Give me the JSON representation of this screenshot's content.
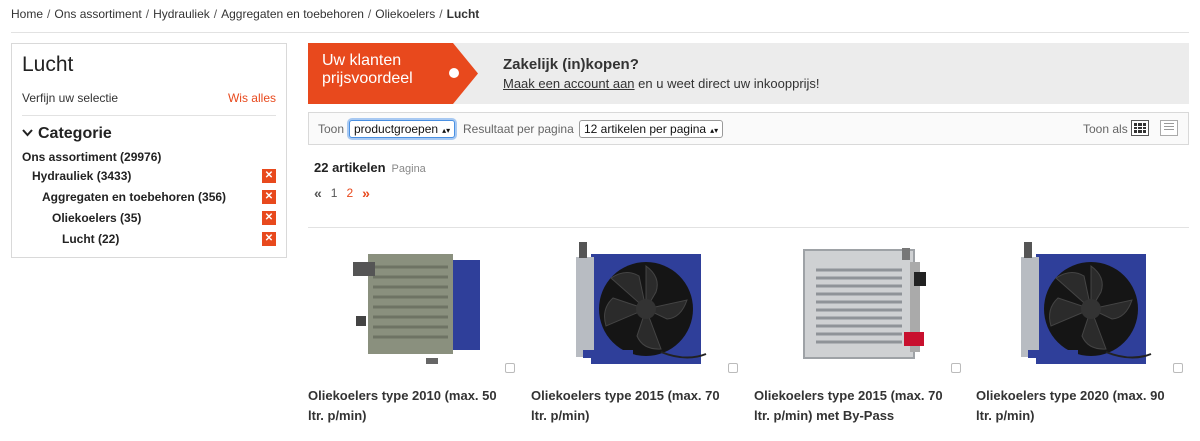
{
  "breadcrumb": {
    "items": [
      "Home",
      "Ons assortiment",
      "Hydrauliek",
      "Aggregaten en toebehoren",
      "Oliekoelers"
    ],
    "current": "Lucht",
    "separator": "/"
  },
  "sidebar": {
    "title": "Lucht",
    "refine_label": "Verfijn uw selectie",
    "clear_all": "Wis alles",
    "category_heading": "Categorie",
    "categories": [
      {
        "label": "Ons assortiment (29976)",
        "removable": false
      },
      {
        "label": "Hydrauliek (3433)",
        "removable": true
      },
      {
        "label": "Aggregaten en toebehoren (356)",
        "removable": true
      },
      {
        "label": "Oliekoelers (35)",
        "removable": true
      },
      {
        "label": "Lucht (22)",
        "removable": true
      }
    ],
    "remove_glyph": "✕"
  },
  "banner": {
    "badge_line1": "Uw klanten",
    "badge_line2": "prijsvoordeel",
    "heading": "Zakelijk (in)kopen?",
    "link_text": "Maak een account aan",
    "rest_text": " en u weet direct uw inkoopprijs!"
  },
  "toolbar": {
    "show_label": "Toon",
    "show_value": "productgroepen",
    "per_page_label": "Resultaat per pagina",
    "per_page_value": "12 artikelen per pagina",
    "view_as_label": "Toon als",
    "select_arrow": "▴▾"
  },
  "results": {
    "count_label": "22 artikelen",
    "page_label": "Pagina",
    "prev": "«",
    "pages": [
      "1",
      "2"
    ],
    "next": "»"
  },
  "products": [
    {
      "line1": "Oliekoelers type 2010 (max. 50",
      "line2": "ltr. p/min)",
      "variant": "gray"
    },
    {
      "line1": "Oliekoelers type 2015 (max. 70",
      "line2": "ltr. p/min)",
      "variant": "fan"
    },
    {
      "line1": "Oliekoelers type 2015 (max. 70",
      "line2": "ltr. p/min) met By-Pass",
      "variant": "grille"
    },
    {
      "line1": "Oliekoelers type 2020 (max. 90",
      "line2": "ltr. p/min)",
      "variant": "fan"
    }
  ],
  "colors": {
    "accent": "#e8491d",
    "frame_blue": "#2f3f9a"
  }
}
